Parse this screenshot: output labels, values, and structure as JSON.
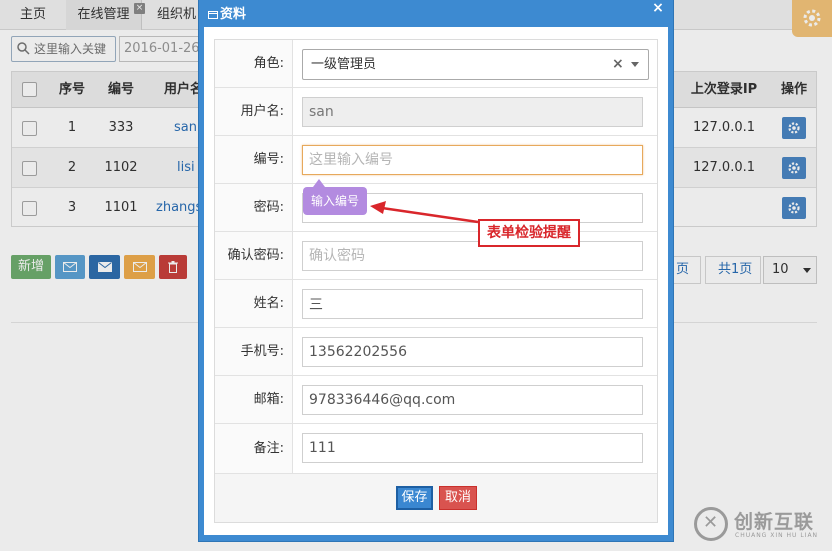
{
  "tabs": [
    {
      "label": "主页"
    },
    {
      "label": "在线管理"
    },
    {
      "label": "组织机"
    }
  ],
  "tab_close_symbol": "×",
  "toolbar": {
    "search_placeholder": "这里输入关键",
    "date_value": "2016-01-26"
  },
  "grid": {
    "columns": [
      "序号",
      "编号",
      "用户名",
      "上次登录IP",
      "操作"
    ],
    "rows": [
      {
        "seq": "1",
        "code": "333",
        "username": "san",
        "ip": "127.0.0.1"
      },
      {
        "seq": "2",
        "code": "1102",
        "username": "lisi",
        "ip": "127.0.0.1"
      },
      {
        "seq": "3",
        "code": "1101",
        "username": "zhangs",
        "ip": ""
      }
    ]
  },
  "buttons": {
    "add": "新增",
    "save": "保存",
    "cancel": "取消"
  },
  "pager": {
    "prev": "页",
    "total": "共1页",
    "page_size": "10"
  },
  "dialog": {
    "title": "资料",
    "close": "×",
    "fields": {
      "role": {
        "label": "角色:",
        "value": "一级管理员",
        "clear": "×"
      },
      "username": {
        "label": "用户名:",
        "value": "san"
      },
      "code": {
        "label": "编号:",
        "placeholder": "这里输入编号"
      },
      "password": {
        "label": "密码:"
      },
      "confirm_password": {
        "label": "确认密码:",
        "placeholder": "确认密码"
      },
      "name": {
        "label": "姓名:",
        "value": "三"
      },
      "phone": {
        "label": "手机号:",
        "value": "13562202556"
      },
      "email": {
        "label": "邮箱:",
        "value": "978336446@qq.com"
      },
      "note": {
        "label": "备注:",
        "value": "111"
      }
    }
  },
  "validation_tip": "输入编号",
  "annotation": "表单检验提醒",
  "watermark": {
    "name": "创新互联",
    "sub": "CHUANG XIN HU LIAN"
  },
  "colors": {
    "dialog_blue": "#3d8ad1",
    "tip_purple": "#b38be0",
    "annotation_red": "#d9262b",
    "save_blue": "#3a87d1",
    "cancel_red": "#d9534f",
    "add_green": "#6fae6f",
    "op_blue": "#4a86c4",
    "gear_orange": "#f5c57b"
  }
}
